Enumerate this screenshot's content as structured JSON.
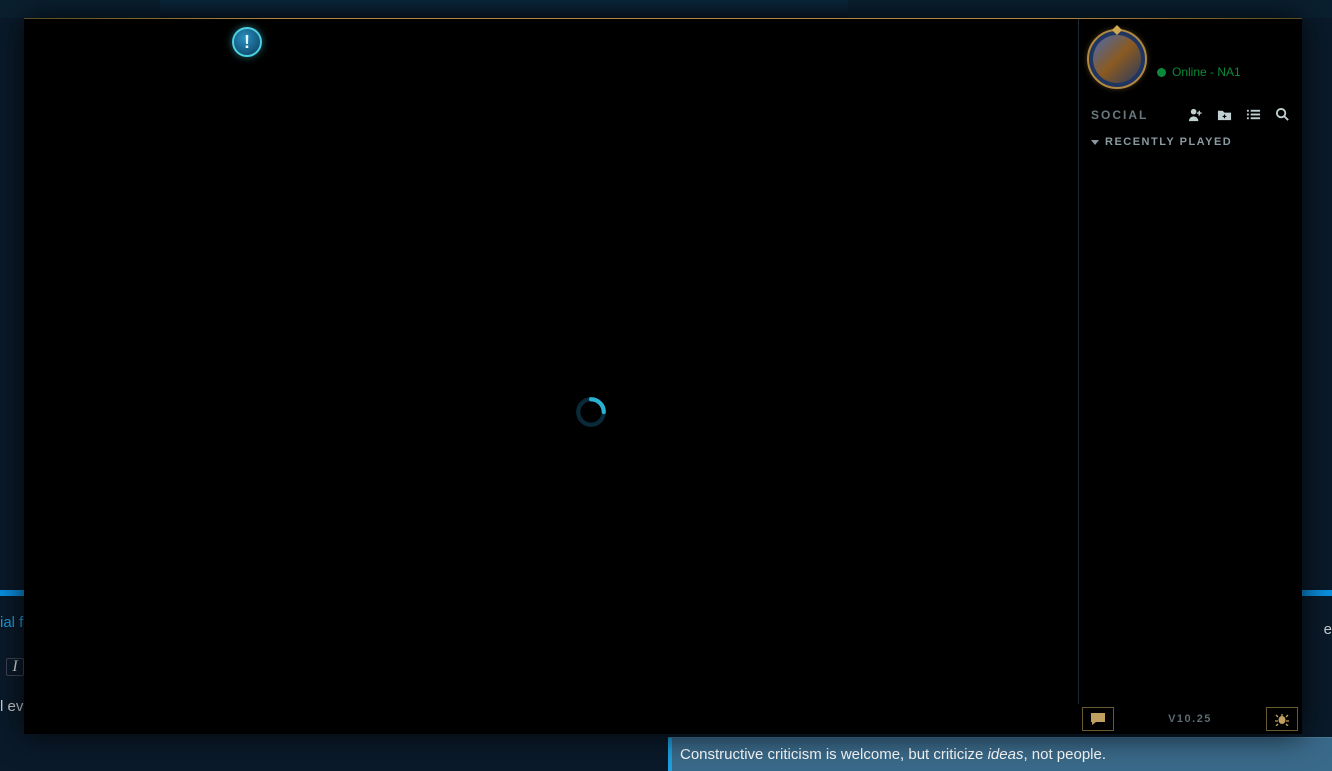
{
  "background": {
    "link_fragment": "ial f",
    "text_fragment": "l ev",
    "right_fragment": "e",
    "italic_glyph": "I"
  },
  "modal": {
    "notification_glyph": "!",
    "status": {
      "text": "Online - NA1"
    },
    "social": {
      "title": "SOCIAL",
      "groups": {
        "recently_played": "RECENTLY PLAYED"
      }
    },
    "footer": {
      "version": "V10.25"
    }
  },
  "tip": {
    "prefix": "Constructive criticism is welcome, but criticize ",
    "emphasis": "ideas",
    "suffix": ", not people."
  }
}
